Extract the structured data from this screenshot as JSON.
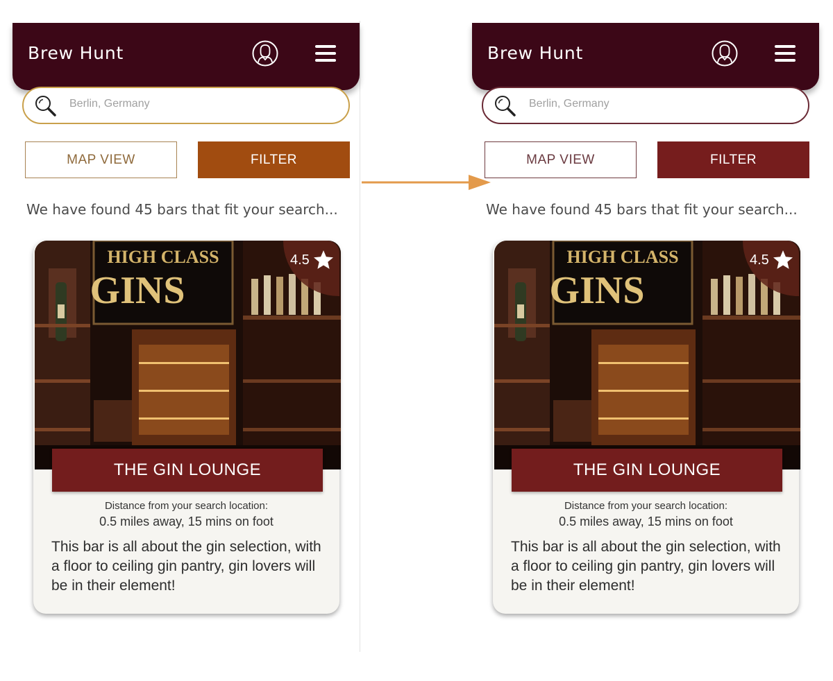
{
  "app": {
    "title": "Brew Hunt"
  },
  "search": {
    "placeholder": "Berlin, Germany"
  },
  "buttons": {
    "map_view": "MAP VIEW",
    "filter": "FILTER"
  },
  "results": {
    "text": "We have found 45 bars that fit your search..."
  },
  "card": {
    "name": "THE GIN LOUNGE",
    "rating": "4.5",
    "sign_text_line1": "HIGH CLASS",
    "sign_text_line2": "GINS",
    "distance_label": "Distance from your search location:",
    "distance_value": "0.5 miles away, 15 mins on foot",
    "description": "This bar is all about the gin selection, with a floor to ceiling gin pantry, gin lovers will be in their element!"
  },
  "icons": {
    "profile": "profile-icon",
    "menu": "hamburger-menu-icon",
    "search": "search-icon",
    "star": "star-icon",
    "arrow": "arrow-right-icon"
  },
  "colors": {
    "header": "#3c0717",
    "filter_before": "#a14c10",
    "filter_after": "#761d1d",
    "search_border_before": "#c9a04b",
    "search_border_after": "#6a2a35",
    "name_banner": "#731d1d",
    "arrow": "#e39a4b"
  }
}
